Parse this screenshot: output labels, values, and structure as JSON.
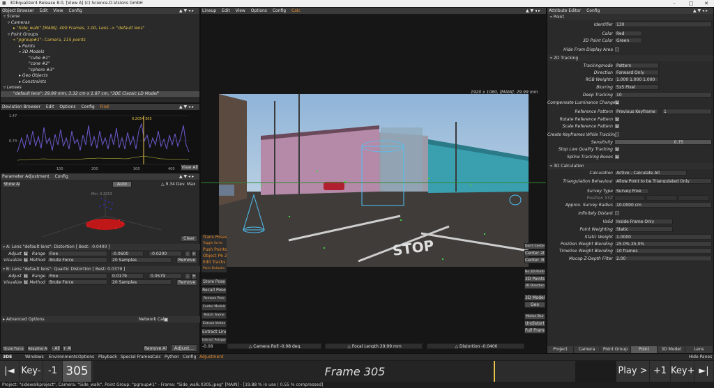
{
  "window": {
    "title": "3DEqualizer4 Release 8.0, [View A]  (c) Science.D.Visions GmbH"
  },
  "object_browser": {
    "menu": [
      "Object Browser",
      "Edit",
      "View",
      "Config"
    ],
    "tree": [
      "Scene",
      "Cameras",
      "\"Side_walk\"  [MAIN], 400 Frames, 1.00, Lens -> \"default lens\"",
      "Point Groups",
      "\"pgroup#1\":  Camera, 115 points",
      "Points",
      "3D Models",
      "\"cube #1\"",
      "\"cone #2\"",
      "\"sphere #3\"",
      "Geo Objects",
      "Constraints",
      "Lenses",
      "\"default lens\": 29.99 mm, 3.32 cm x 1.87 cm, \"3DE Classic LD Model\""
    ]
  },
  "deviation_browser": {
    "menu": [
      "Deviation Browser",
      "Edit",
      "Options",
      "Config",
      "Find"
    ],
    "y_top": "1.47",
    "y_mid": "0.74",
    "x_ticks": [
      "100",
      "200",
      "300",
      "400"
    ],
    "marker": "0.2054 305",
    "view_all": "View All"
  },
  "param_adjust": {
    "menu": [
      "Parameter Adjustment",
      "Config"
    ],
    "show_all": "Show All",
    "auto": "Auto",
    "dev": "△ 9.34 Dev. Max",
    "min_label": "Min: 0.2253",
    "clear": "Clear",
    "a_title": "A: Lens \"default lens\": Distortion  [ Best: -0.0400 ]",
    "b_title": "B: Lens \"default lens\": Quartic Distortion  [ Best: 0.0379 ]",
    "adjust": "Adjust",
    "range": "Range",
    "visualize": "Visualize",
    "method": "Method",
    "a_range_type": "Fine",
    "a_range_min": "-0.0600",
    "a_range_max": "-0.0200",
    "a_method": "Brute Force",
    "a_samples": "20 Samples",
    "b_range_type": "Fine",
    "b_range_min": "0.0179",
    "b_range_max": "0.0579",
    "b_method": "Brute Force",
    "b_samples": "20 Samples",
    "remove": "Remove",
    "advanced": "Advanced Options",
    "network_calc": "Network Calc",
    "brute_all": "Brute Force All",
    "adaptive_all": "Adaptive All",
    "minus_all": "- All",
    "plus_all": "+ All",
    "remove_all": "Remove All",
    "adjust_btn": "Adjust..."
  },
  "lineup": {
    "menu": [
      "Lineup",
      "Edit",
      "View",
      "Options",
      "Config",
      "Calc"
    ],
    "info": "1920 x 1080, [MAIN], 29.99 mm",
    "left_buttons": [
      "Trans Poses",
      "Toggle Scr4c",
      "Push Points",
      "Object P6 2",
      "Edit Tracks",
      "Point Defaults"
    ],
    "left_gray": [
      "Store Pose",
      "Recall Pose",
      "Remove Pose",
      "Center Models",
      "Match Frame",
      "Extract Vertex",
      "Extract Line",
      "Extract Polygon"
    ],
    "right_buttons": [
      "Don't Center",
      "Center 2D",
      "Center 3D",
      "No 3D Points",
      "3D Points",
      "3D Direction",
      "3D Models",
      "Geo",
      "Motion Blur",
      "Undistort",
      "Full Frame"
    ],
    "value": "-0.08",
    "camera_roll": "△ Camera Roll -0.08 deg.",
    "focal": "△ Focal Length 29.99 mm",
    "distortion": "△ Distortion -0.0400",
    "sign_text": "STOP"
  },
  "attribute_editor": {
    "menu": [
      "Attribute Editor",
      "Config"
    ],
    "point_section": "Point",
    "identifier_lbl": "Identifier",
    "identifier": "130",
    "color_lbl": "Color",
    "color": "Red",
    "color3d_lbl": "3D Point Color",
    "color3d": "Green",
    "hide_lbl": "Hide From Display Area",
    "tracking_section": "2D Tracking",
    "trackmode_lbl": "Trackingmode",
    "trackmode": "Pattern",
    "direction_lbl": "Direction",
    "direction": "Forward Only",
    "rgb_lbl": "RGB Weights",
    "rgb": "1.000  1.000  1.000",
    "blurring_lbl": "Blurring",
    "blurring": "5x5 Pixel",
    "deep_lbl": "Deep Tracking",
    "deep": "10",
    "comp_lbl": "Compensate Luminance Changes",
    "refpat_lbl": "Reference Pattern",
    "refpat": "Previous Keyframe",
    "refpat_n": "1",
    "rotate_lbl": "Rotate Reference Pattern",
    "scale_lbl": "Scale Reference Pattern",
    "create_lbl": "Create Keyframes While Tracking",
    "sens_lbl": "Sensitivity",
    "sens": "0.75",
    "stoplow_lbl": "Stop Low Quality Tracking",
    "spline_lbl": "Spline Tracking Boxes",
    "calc_section": "3D Calculation",
    "calc_lbl": "Calculation",
    "calc": "Active - Calculate All",
    "tri_lbl": "Triangulation Behaviour",
    "tri": "Allow Point to be Triangulated Only",
    "survey_lbl": "Survey Type",
    "survey": "Survey Free",
    "pos_lbl": "Position XYZ",
    "approx_lbl": "Approx. Survey Radius",
    "approx": "10.0000 cm",
    "inf_lbl": "Infinitely Distant",
    "valid_lbl": "Valid",
    "valid": "Inside Frame Only",
    "pw_lbl": "Point Weighting",
    "pw": "Static",
    "sw_lbl": "Static Weight",
    "sw": "1.0000",
    "pwb_lbl": "Position Weight Blending",
    "pwb": "25.0%  25.0%",
    "twb_lbl": "Timeline Weight Blending",
    "twb": "10 frames",
    "mocap_lbl": "Mocap Z-Depth Filter",
    "mocap": "2.00",
    "tabs": [
      "Project",
      "Camera",
      "Point Group",
      "Point",
      "3D Model",
      "Lens"
    ],
    "active_tab": "Point"
  },
  "main_menu": [
    "3DE",
    "Windows",
    "Environments",
    "Options",
    "Playback",
    "Special Frames",
    "Calc",
    "Python",
    "Config",
    "Adjustment"
  ],
  "hide_panes": "Hide Panes",
  "timeline": {
    "start": "|◄",
    "keyminus": "Key-",
    "minus1": "-1",
    "frame_num": "305",
    "frame_label": "Frame 305",
    "play": "Play >",
    "plus1": "+1",
    "keyplus": "Key+",
    "end": "►|"
  },
  "status": "Project: \"sidewalkproject\", Camera: \"Side_walk\", Point Group: \"pgroup#1\" - Frame: \"Side_walk.0305.jpeg\"  [MAIN]  -  [19.88 % in use | 0.55 % compressed]",
  "colors": {
    "accent": "#e88a2a",
    "selected": "#e6c34a",
    "curve": "#6a5acd",
    "red_points": "#e02020"
  }
}
